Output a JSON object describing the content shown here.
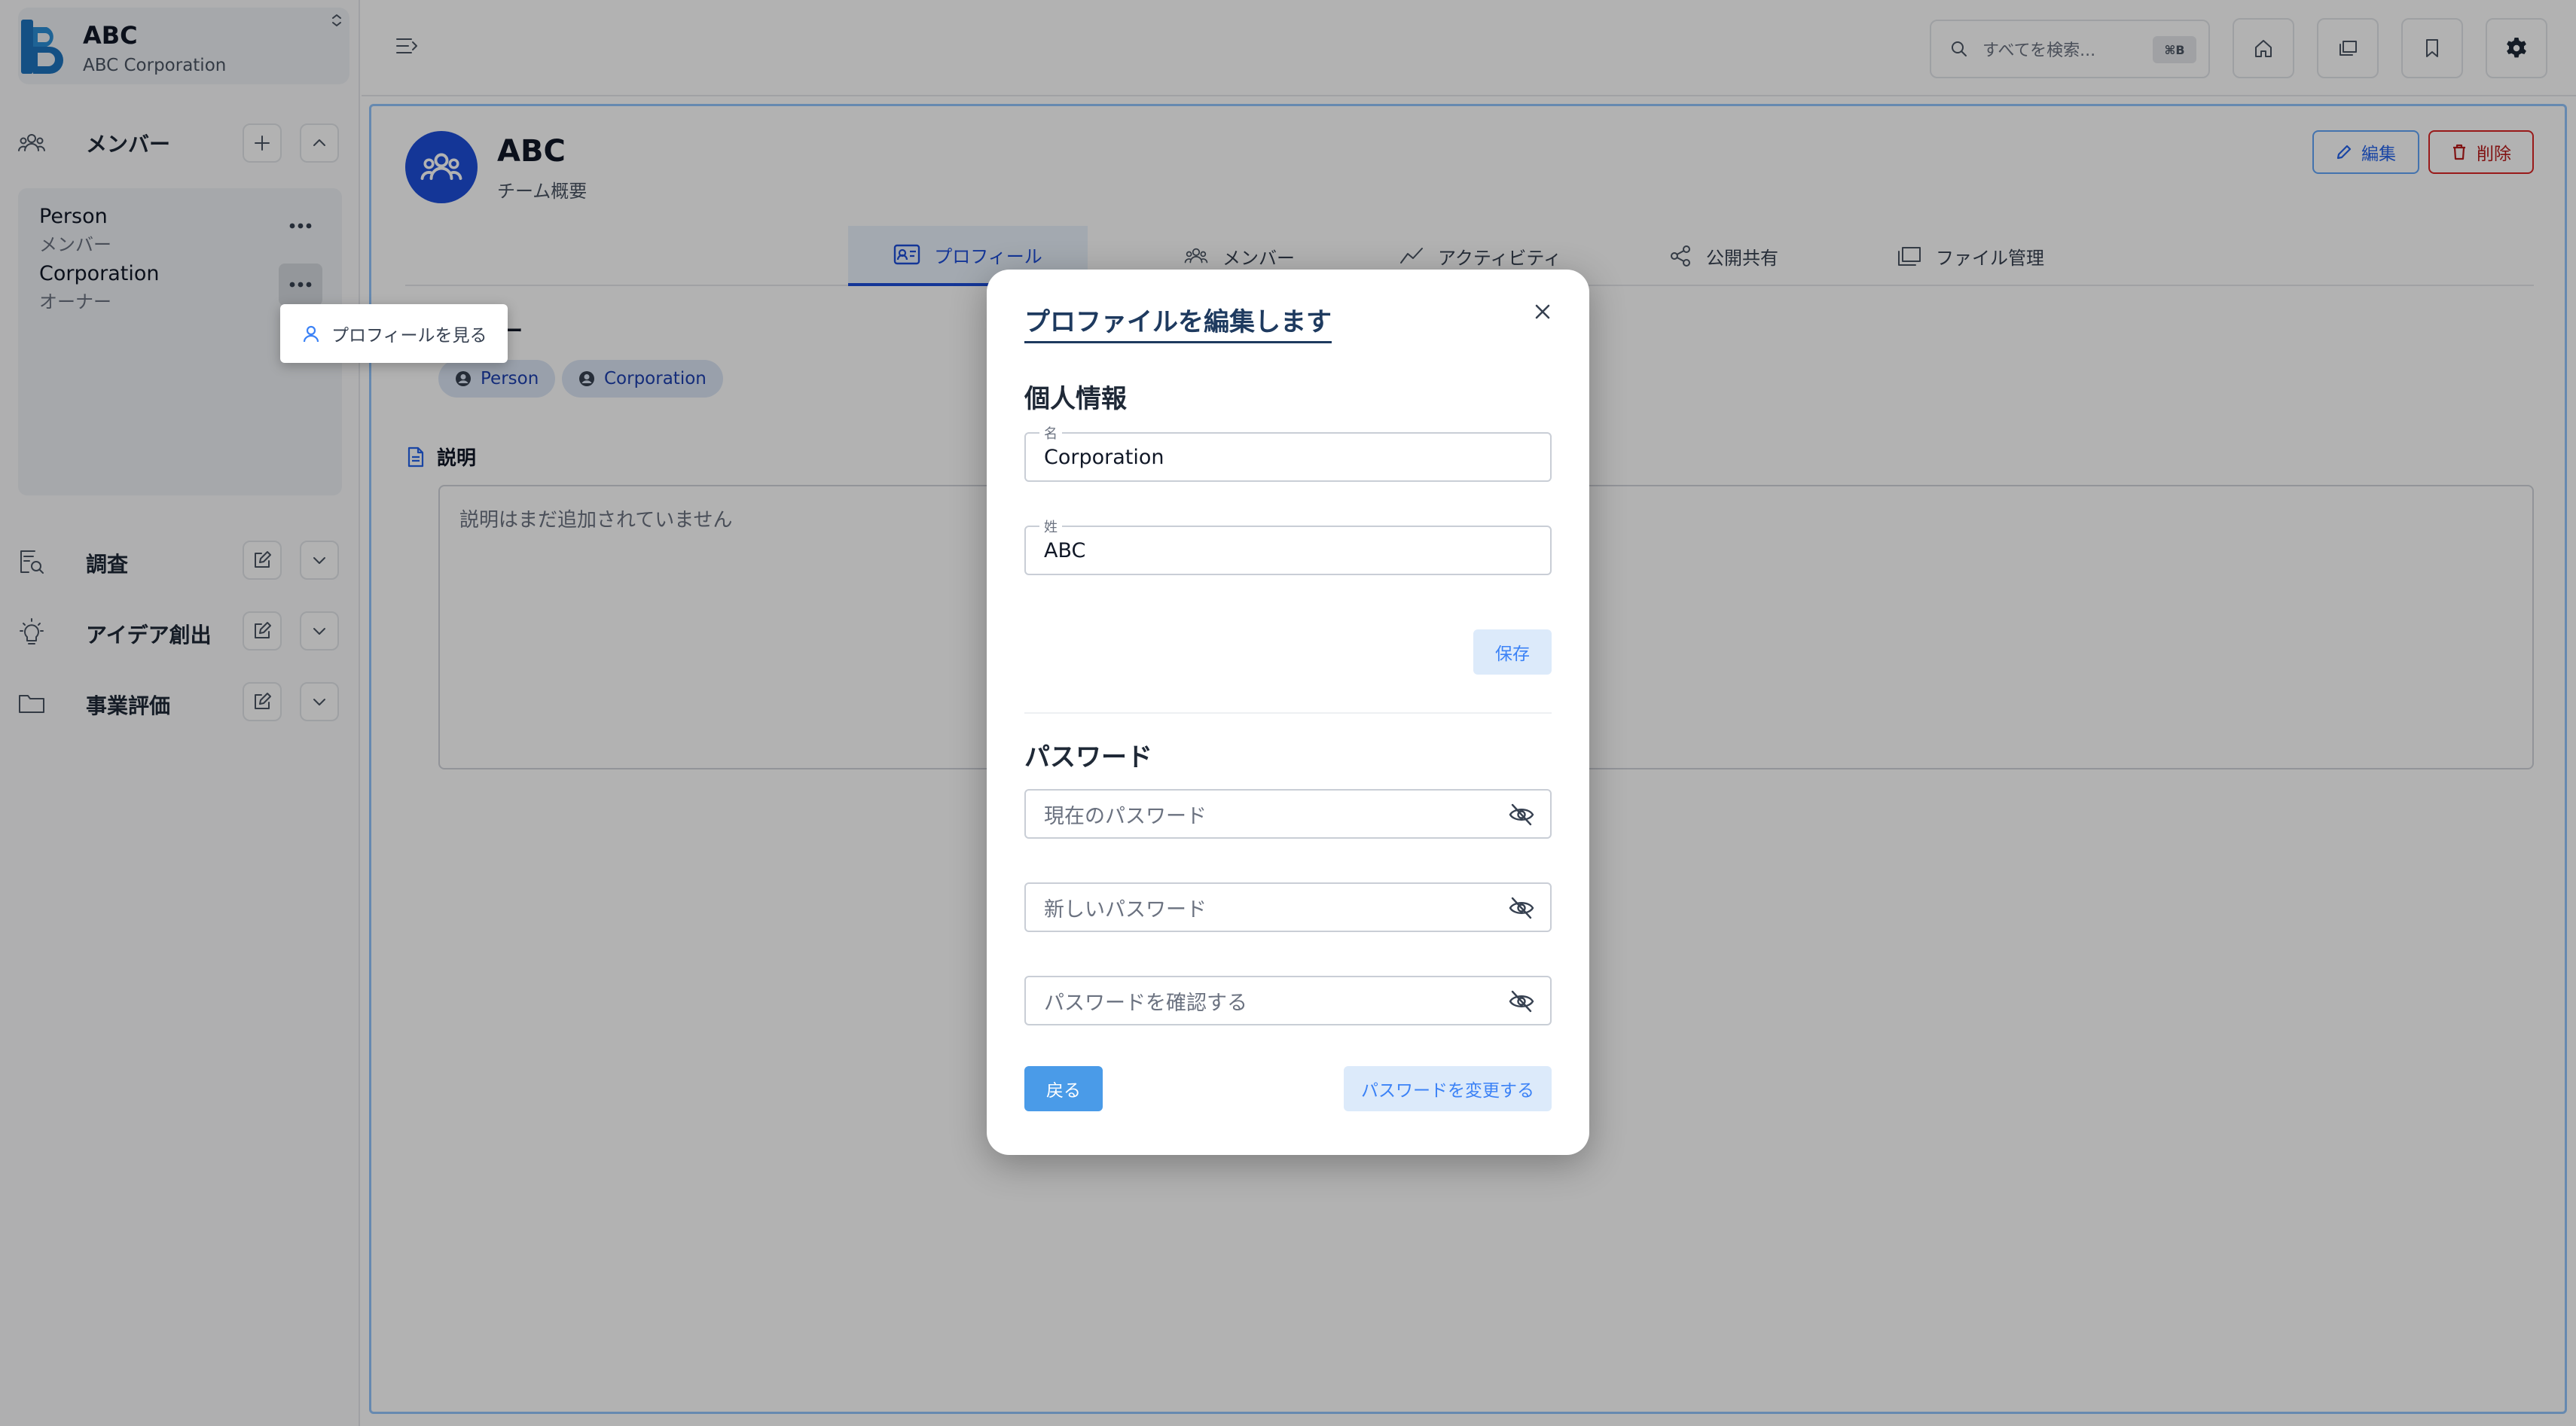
{
  "sidebar": {
    "team_name": "ABC",
    "team_org": "ABC Corporation",
    "members_title": "メンバー",
    "members": [
      {
        "name": "Person",
        "role": "メンバー"
      },
      {
        "name": "Corporation",
        "role": "オーナー"
      }
    ],
    "context_menu_item": "プロフィールを見る",
    "sections": [
      {
        "label": "調査",
        "icon": "research-icon"
      },
      {
        "label": "アイデア創出",
        "icon": "lightbulb-icon"
      },
      {
        "label": "事業評価",
        "icon": "folder-icon"
      }
    ]
  },
  "header": {
    "search_placeholder": "すべてを検索...",
    "search_shortcut": "⌘B"
  },
  "team_page": {
    "title": "ABC",
    "subtitle": "チーム概要",
    "edit_label": "編集",
    "delete_label": "削除",
    "tabs": [
      "プロフィール",
      "メンバー",
      "アクティビティ",
      "公開共有",
      "ファイル管理"
    ],
    "members_heading": "メンバー",
    "member_chips": [
      "Person",
      "Corporation"
    ],
    "description_heading": "説明",
    "description_placeholder": "説明はまだ追加されていません"
  },
  "modal": {
    "title": "プロファイルを編集します",
    "personal_heading": "個人情報",
    "first_name_label": "名",
    "first_name_value": "Corporation",
    "last_name_label": "姓",
    "last_name_value": "ABC",
    "save_label": "保存",
    "password_heading": "パスワード",
    "current_password_placeholder": "現在のパスワード",
    "new_password_placeholder": "新しいパスワード",
    "confirm_password_placeholder": "パスワードを確認する",
    "back_label": "戻る",
    "change_password_label": "パスワードを変更する"
  },
  "colors": {
    "brand_blue": "#1d4ed8",
    "accent_blue": "#3b82f6",
    "danger_red": "#dc2626"
  }
}
